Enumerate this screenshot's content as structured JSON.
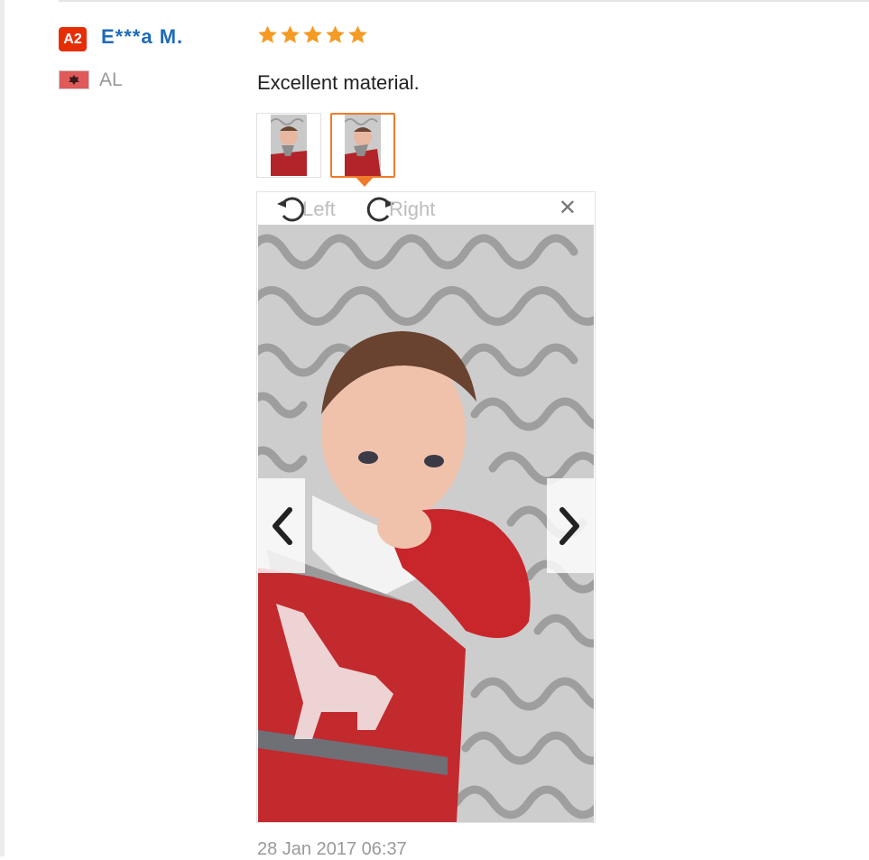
{
  "reviewer": {
    "level_badge": "A2",
    "name": "E***a M.",
    "country": "AL",
    "flag_icon": "albania-flag-icon"
  },
  "review": {
    "rating": 5,
    "rating_max": 5,
    "text": "Excellent material.",
    "timestamp": "28 Jan 2017 06:37"
  },
  "gallery": {
    "thumbnail_count": 2,
    "selected_index": 1,
    "toolbar": {
      "rotate_left_label": "Left",
      "rotate_right_label": "Right",
      "close_icon": "close-icon"
    },
    "prev_icon": "chevron-left-icon",
    "next_icon": "chevron-right-icon"
  },
  "colors": {
    "badge": "#e62e04",
    "name_link": "#1f6bb8",
    "star": "#f59a23",
    "selected_border": "#f07a2a"
  }
}
